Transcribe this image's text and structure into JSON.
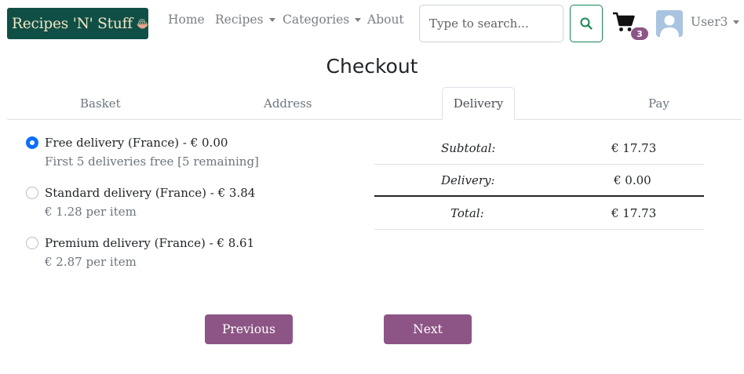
{
  "navbar": {
    "brand": "Recipes 'N' Stuff",
    "links": [
      "Home",
      "Recipes",
      "Categories",
      "About"
    ],
    "search": {
      "placeholder": "Type to search...",
      "value": ""
    },
    "cart_count": "3",
    "user": "User3"
  },
  "title": "Checkout",
  "tabs": [
    "Basket",
    "Address",
    "Delivery",
    "Pay"
  ],
  "active_tab": "Delivery",
  "delivery_options": [
    {
      "label": "Free delivery (France) - € 0.00",
      "description": "First 5 deliveries free [5 remaining]",
      "selected": true
    },
    {
      "label": "Standard delivery (France) - € 3.84",
      "description": "€ 1.28 per item",
      "selected": false
    },
    {
      "label": "Premium delivery (France) - € 8.61",
      "description": "€ 2.87 per item",
      "selected": false
    }
  ],
  "summary": {
    "subtotal_label": "Subtotal:",
    "subtotal_value": "€ 17.73",
    "delivery_label": "Delivery:",
    "delivery_value": "€ 0.00",
    "total_label": "Total:",
    "total_value": "€ 17.73"
  },
  "buttons": {
    "previous": "Previous",
    "next": "Next"
  },
  "colors": {
    "brand_bg": "#0f4f46",
    "brand_text": "#f3e6c4",
    "accent": "#8c5585",
    "search_button_border": "#198754",
    "radio_checked": "#0d6efd"
  }
}
